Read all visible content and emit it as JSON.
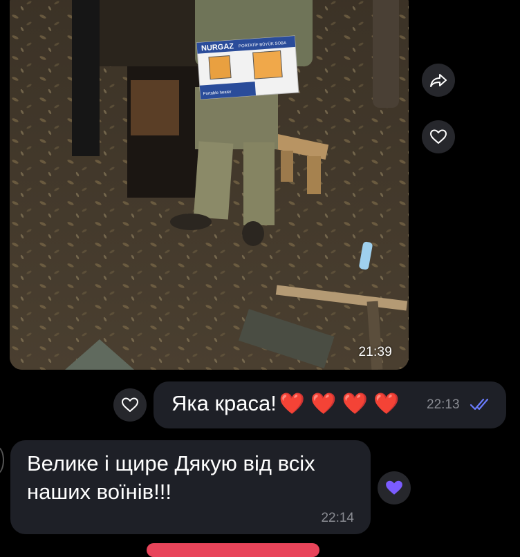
{
  "photo_message": {
    "time": "21:39",
    "box_brand": "NURGAZ",
    "box_caption": "PORTATİF BÜYÜK SOBA",
    "box_subtitle": "Portable heater"
  },
  "side_actions": {
    "forward_icon": "share-forward-icon",
    "like_icon": "heart-outline-icon"
  },
  "outgoing_message": {
    "text": "Яка краса!",
    "hearts": [
      "❤️",
      "❤️",
      "❤️",
      "❤️"
    ],
    "time": "22:13",
    "status_icon": "double-check-read-icon",
    "reaction_button_icon": "heart-outline-icon"
  },
  "incoming_message": {
    "text": "Велике і щире Дякую від всіх наших воїнів!!!",
    "time": "22:14",
    "reaction_icon": "heart-filled-purple-icon"
  },
  "colors": {
    "background": "#000000",
    "bubble": "#1e2027",
    "reaction_purple": "#7b5cff",
    "check_blue": "#6a7cff",
    "heart_red": "#e0202e"
  }
}
